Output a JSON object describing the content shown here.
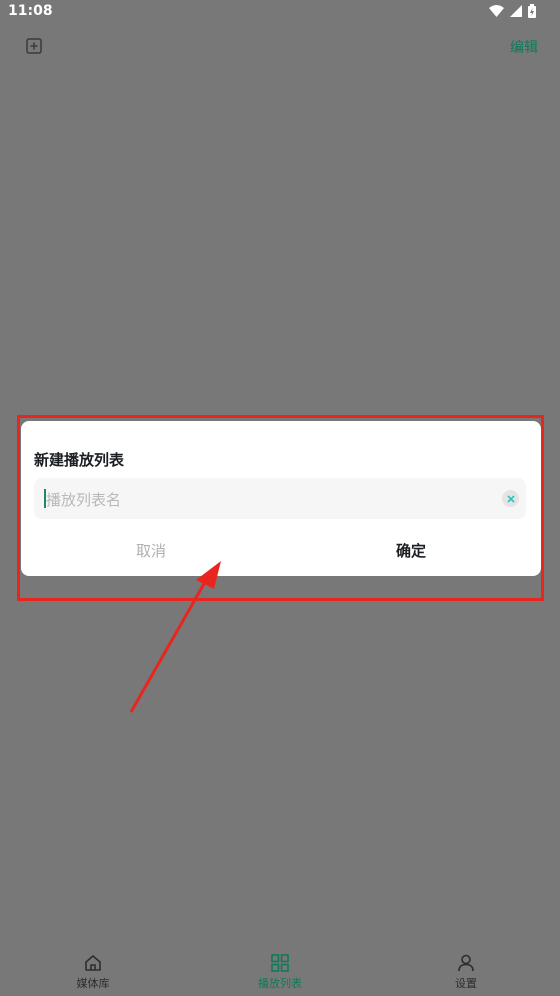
{
  "status_bar": {
    "time": "11:08",
    "icons": [
      "wifi-icon",
      "signal-icon",
      "battery-icon"
    ]
  },
  "header": {
    "add_icon": "add-square-icon",
    "edit_label": "编辑"
  },
  "dialog": {
    "title": "新建播放列表",
    "input": {
      "value": "",
      "placeholder": "播放列表名"
    },
    "clear_icon": "close-circle-icon",
    "cancel_label": "取消",
    "confirm_label": "确定"
  },
  "bottom_nav": {
    "items": [
      {
        "label": "媒体库",
        "icon": "home-icon",
        "active": false
      },
      {
        "label": "播放列表",
        "icon": "grid-icon",
        "active": true
      },
      {
        "label": "设置",
        "icon": "person-icon",
        "active": false
      }
    ]
  },
  "colors": {
    "scrim": "#787878",
    "accent": "#0f7a5a",
    "annotation": "#e8251f"
  }
}
